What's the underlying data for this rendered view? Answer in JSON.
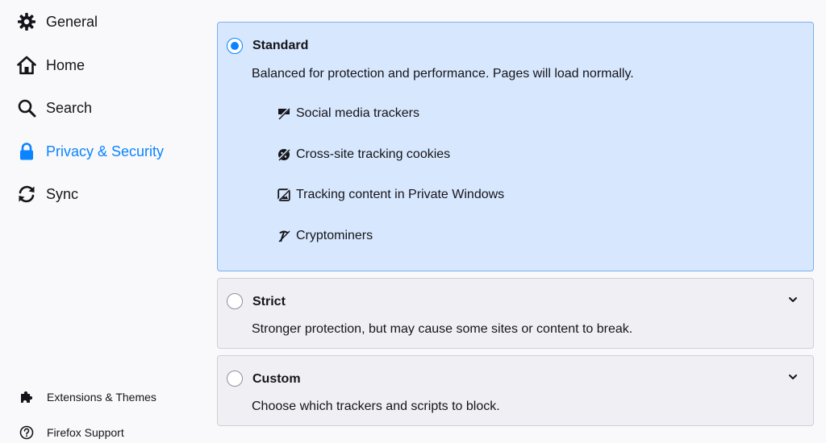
{
  "sidebar": {
    "items": [
      {
        "label": "General",
        "icon": "gear-icon"
      },
      {
        "label": "Home",
        "icon": "home-icon"
      },
      {
        "label": "Search",
        "icon": "search-icon"
      },
      {
        "label": "Privacy & Security",
        "icon": "lock-icon",
        "selected": true
      },
      {
        "label": "Sync",
        "icon": "sync-icon"
      }
    ],
    "footer": [
      {
        "label": "Extensions & Themes",
        "icon": "puzzle-icon"
      },
      {
        "label": "Firefox Support",
        "icon": "help-icon"
      }
    ]
  },
  "protection": {
    "standard": {
      "title": "Standard",
      "selected": true,
      "description": "Balanced for protection and performance. Pages will load normally.",
      "trackers": [
        {
          "label": "Social media trackers",
          "icon": "social-tracker-icon"
        },
        {
          "label": "Cross-site tracking cookies",
          "icon": "cookie-icon"
        },
        {
          "label": "Tracking content in Private Windows",
          "icon": "tracking-content-icon"
        },
        {
          "label": "Cryptominers",
          "icon": "cryptominer-icon"
        }
      ]
    },
    "strict": {
      "title": "Strict",
      "selected": false,
      "description": "Stronger protection, but may cause some sites or content to break."
    },
    "custom": {
      "title": "Custom",
      "selected": false,
      "description": "Choose which trackers and scripts to block."
    }
  },
  "colors": {
    "accent": "#0a84ff",
    "selected_bg": "#d7e7fd",
    "option_bg": "#f0f0f4"
  }
}
